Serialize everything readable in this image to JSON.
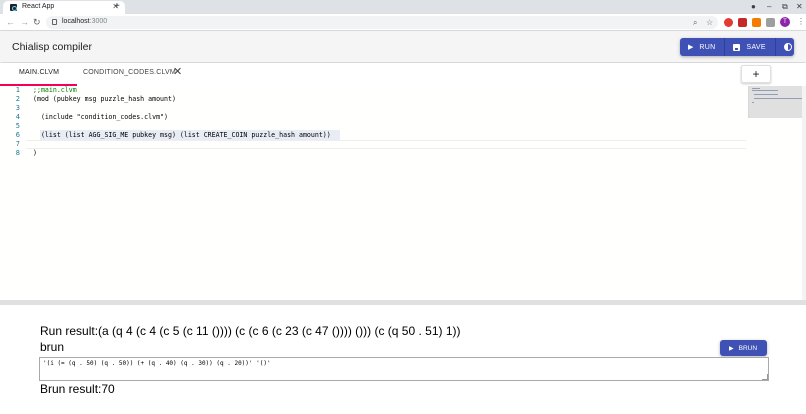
{
  "browser": {
    "tab_title": "React App",
    "url_host": "localhost",
    "url_port": ":3000",
    "profile_initial": "T"
  },
  "app": {
    "title": "Chialisp compiler",
    "buttons": {
      "run": "RUN",
      "save": "SAVE"
    },
    "accent_color": "#3f51b5",
    "tab_indicator_color": "#f50057"
  },
  "editor": {
    "tabs": [
      {
        "label": "MAIN.CLVM",
        "active": true
      },
      {
        "label": "CONDITION_CODES.CLVM",
        "active": false
      }
    ],
    "add_tab_label": "+",
    "line_numbers": [
      "1",
      "2",
      "3",
      "4",
      "5",
      "6",
      "7",
      "8"
    ],
    "lines": [
      ";;main.clvm",
      "(mod (pubkey msg puzzle_hash amount)",
      "",
      "  (include \"condition_codes.clvm\")",
      "",
      "  (list (list AGG_SIG_ME pubkey msg) (list CREATE_COIN puzzle_hash amount))",
      "",
      ")"
    ]
  },
  "results": {
    "run_result": "Run result:(a (q 4 (c 4 (c 5 (c 11 ()))) (c (c 6 (c 23 (c 47 ()))) ())) (c (q 50 . 51) 1))",
    "brun_label": "brun",
    "brun_button": "BRUN",
    "brun_input_value": "'(i (= (q . 50) (q . 50)) (+ (q . 40) (q . 30)) (q . 20))' '()'",
    "brun_result": "Brun result:70"
  }
}
